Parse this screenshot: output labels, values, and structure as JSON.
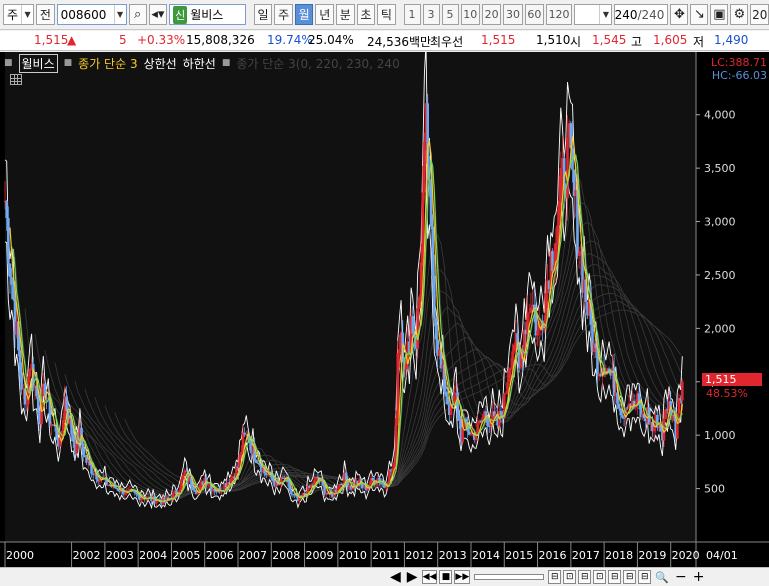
{
  "toolbar": {
    "market": "주",
    "jeon": "전",
    "code": "008600",
    "sin": "신",
    "stock_name": "윌비스",
    "periods": [
      "일",
      "주",
      "월",
      "년"
    ],
    "active_period": "월",
    "units": [
      "분",
      "초",
      "틱"
    ],
    "nums": [
      "1",
      "3",
      "5",
      "10",
      "20",
      "30",
      "60",
      "120"
    ],
    "count": "240",
    "count_total": "/240",
    "cut": "20"
  },
  "quote": {
    "price": "1,515",
    "change_arrow": "▲",
    "change": "5",
    "change_pct": "+0.33%",
    "volume": "15,808,326",
    "turnover_pct": "19.74%",
    "ratio_pct": "25.04%",
    "amount": "24,536백만",
    "best_label": "최우선",
    "best_ask": "1,515",
    "best_bid": "1,510",
    "open_label": "시",
    "open": "1,545",
    "high_label": "고",
    "high": "1,605",
    "low_label": "저",
    "low": "1,490"
  },
  "legend": {
    "name": "윌비스",
    "ma": "종가 단순 3",
    "upper": "상한선",
    "lower": "하한선",
    "avg": "종가 단순 3(0, 220, 230, 240"
  },
  "chart": {
    "lc": "LC:388.71",
    "hc": "HC:-66.03",
    "current_price": "1,515",
    "current_pct": "48.53%",
    "colors": {
      "up": "#e0262f",
      "down": "#6fa8f0",
      "ma": "#f7c925",
      "upper": "#ffffff",
      "lower": "#ffffff",
      "green": "#7cd65a",
      "avg": "#3a3a3a"
    }
  },
  "chart_data": {
    "type": "candlestick",
    "y_ticks": [
      500,
      1000,
      1500,
      2000,
      2500,
      3000,
      3500,
      4000
    ],
    "y_tick_labels": [
      "500",
      "1,000",
      "1,500",
      "2,000",
      "2,500",
      "3,000",
      "3,500",
      "4,000"
    ],
    "ylim": [
      0,
      4400
    ],
    "x_ticks": [
      2000,
      2002,
      2003,
      2004,
      2005,
      2006,
      2007,
      2008,
      2009,
      2010,
      2011,
      2012,
      2013,
      2014,
      2015,
      2016,
      2017,
      2018,
      2019,
      2020
    ],
    "x_tick_labels": [
      "2000",
      "2002",
      "2003",
      "2004",
      "2005",
      "2006",
      "2007",
      "2008",
      "2009",
      "2010",
      "2011",
      "2012",
      "2013",
      "2014",
      "2015",
      "2016",
      "2017",
      "2018",
      "2019",
      "2020"
    ],
    "x_right_label": "04/01",
    "xlim": [
      2000.0,
      2020.4
    ],
    "close_points": [
      [
        2000.0,
        3200
      ],
      [
        2000.15,
        2600
      ],
      [
        2000.3,
        2100
      ],
      [
        2000.45,
        1600
      ],
      [
        2000.6,
        1250
      ],
      [
        2000.75,
        1700
      ],
      [
        2000.9,
        1450
      ],
      [
        2001.05,
        1200
      ],
      [
        2001.2,
        1450
      ],
      [
        2001.35,
        1150
      ],
      [
        2001.5,
        1050
      ],
      [
        2001.65,
        900
      ],
      [
        2001.8,
        1350
      ],
      [
        2001.95,
        1100
      ],
      [
        2002.1,
        900
      ],
      [
        2002.25,
        1000
      ],
      [
        2002.4,
        780
      ],
      [
        2002.55,
        700
      ],
      [
        2002.7,
        650
      ],
      [
        2002.85,
        600
      ],
      [
        2003.0,
        560
      ],
      [
        2003.2,
        520
      ],
      [
        2003.4,
        500
      ],
      [
        2003.6,
        470
      ],
      [
        2003.8,
        450
      ],
      [
        2004.0,
        430
      ],
      [
        2004.2,
        420
      ],
      [
        2004.4,
        400
      ],
      [
        2004.6,
        390
      ],
      [
        2004.8,
        380
      ],
      [
        2005.0,
        420
      ],
      [
        2005.2,
        480
      ],
      [
        2005.4,
        650
      ],
      [
        2005.6,
        550
      ],
      [
        2005.8,
        470
      ],
      [
        2006.0,
        600
      ],
      [
        2006.2,
        520
      ],
      [
        2006.4,
        480
      ],
      [
        2006.6,
        540
      ],
      [
        2006.8,
        600
      ],
      [
        2007.0,
        700
      ],
      [
        2007.15,
        950
      ],
      [
        2007.3,
        1000
      ],
      [
        2007.45,
        850
      ],
      [
        2007.6,
        780
      ],
      [
        2007.8,
        650
      ],
      [
        2008.0,
        600
      ],
      [
        2008.2,
        520
      ],
      [
        2008.4,
        600
      ],
      [
        2008.6,
        450
      ],
      [
        2008.8,
        380
      ],
      [
        2009.0,
        450
      ],
      [
        2009.2,
        520
      ],
      [
        2009.4,
        600
      ],
      [
        2009.6,
        480
      ],
      [
        2009.8,
        430
      ],
      [
        2010.0,
        520
      ],
      [
        2010.2,
        600
      ],
      [
        2010.4,
        520
      ],
      [
        2010.6,
        560
      ],
      [
        2010.8,
        500
      ],
      [
        2011.0,
        560
      ],
      [
        2011.2,
        600
      ],
      [
        2011.4,
        520
      ],
      [
        2011.55,
        650
      ],
      [
        2011.7,
        700
      ],
      [
        2011.8,
        1800
      ],
      [
        2011.9,
        2000
      ],
      [
        2012.05,
        1600
      ],
      [
        2012.2,
        2100
      ],
      [
        2012.35,
        1900
      ],
      [
        2012.45,
        2300
      ],
      [
        2012.55,
        3200
      ],
      [
        2012.65,
        3800
      ],
      [
        2012.8,
        2800
      ],
      [
        2012.95,
        2000
      ],
      [
        2013.1,
        1600
      ],
      [
        2013.25,
        1400
      ],
      [
        2013.4,
        1200
      ],
      [
        2013.55,
        1350
      ],
      [
        2013.7,
        1000
      ],
      [
        2013.85,
        1100
      ],
      [
        2014.0,
        1000
      ],
      [
        2014.2,
        1050
      ],
      [
        2014.4,
        1200
      ],
      [
        2014.6,
        1150
      ],
      [
        2014.8,
        1100
      ],
      [
        2015.0,
        1300
      ],
      [
        2015.15,
        1700
      ],
      [
        2015.3,
        1900
      ],
      [
        2015.45,
        1600
      ],
      [
        2015.6,
        2000
      ],
      [
        2015.8,
        2300
      ],
      [
        2016.0,
        1950
      ],
      [
        2016.2,
        2200
      ],
      [
        2016.35,
        2600
      ],
      [
        2016.5,
        2800
      ],
      [
        2016.65,
        3100
      ],
      [
        2016.8,
        3500
      ],
      [
        2016.95,
        3600
      ],
      [
        2017.1,
        3200
      ],
      [
        2017.25,
        2800
      ],
      [
        2017.4,
        2400
      ],
      [
        2017.55,
        2100
      ],
      [
        2017.7,
        1800
      ],
      [
        2017.85,
        1650
      ],
      [
        2018.0,
        1700
      ],
      [
        2018.2,
        1550
      ],
      [
        2018.4,
        1400
      ],
      [
        2018.55,
        1200
      ],
      [
        2018.7,
        1350
      ],
      [
        2018.85,
        1250
      ],
      [
        2019.0,
        1300
      ],
      [
        2019.15,
        1150
      ],
      [
        2019.3,
        1200
      ],
      [
        2019.45,
        1050
      ],
      [
        2019.6,
        1150
      ],
      [
        2019.75,
        1000
      ],
      [
        2019.9,
        1300
      ],
      [
        2020.05,
        1200
      ],
      [
        2020.15,
        1050
      ],
      [
        2020.25,
        1400
      ],
      [
        2020.35,
        1515
      ]
    ]
  },
  "bottom": {
    "left_arrow": "◀",
    "right_arrow": "▶",
    "btns": [
      "◀◀",
      "■",
      "▶▶"
    ],
    "icons": [
      "⊟",
      "⊡",
      "⊟",
      "⊡",
      "⊟",
      "⊟",
      "⊟"
    ],
    "zoom_icon": "🔍",
    "minus": "−",
    "plus": "+"
  }
}
